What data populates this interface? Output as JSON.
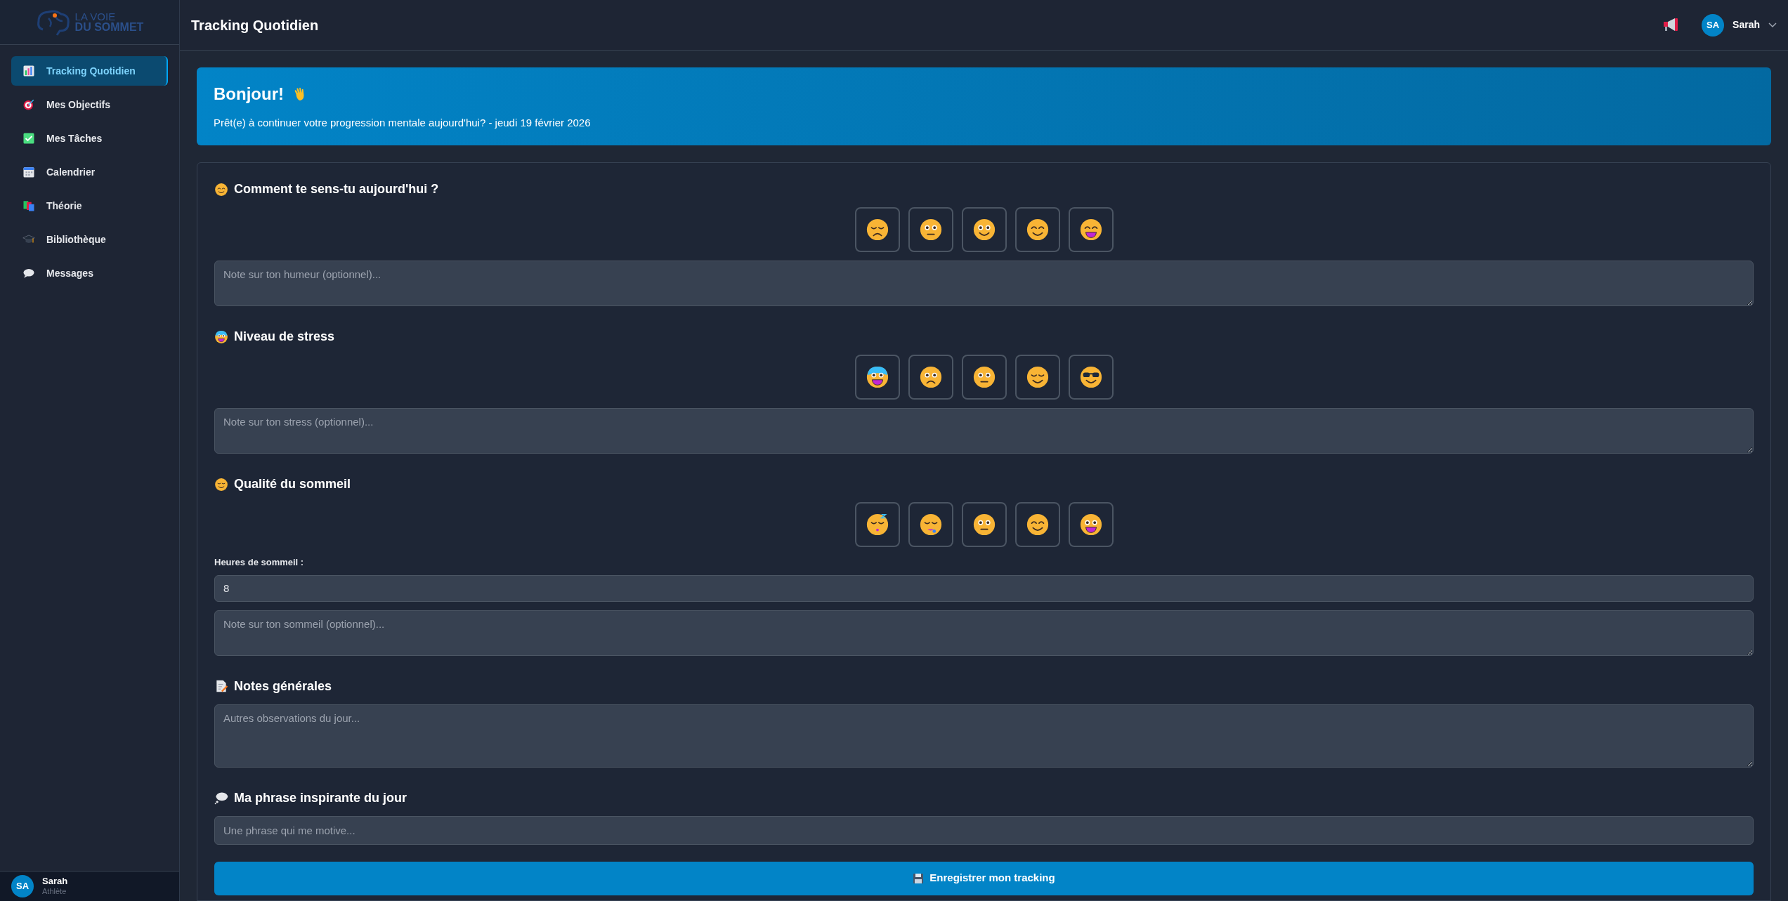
{
  "sidebar": {
    "logo": {
      "line1": "LA VOIE",
      "line2": "DU SOMMET"
    },
    "items": [
      {
        "label": "Tracking Quotidien",
        "selected": true
      },
      {
        "label": "Mes Objectifs",
        "selected": false
      },
      {
        "label": "Mes Tâches",
        "selected": false
      },
      {
        "label": "Calendrier",
        "selected": false
      },
      {
        "label": "Théorie",
        "selected": false
      },
      {
        "label": "Bibliothèque",
        "selected": false
      },
      {
        "label": "Messages",
        "selected": false
      }
    ],
    "user": {
      "initials": "SA",
      "name": "Sarah",
      "role": "Athlète"
    }
  },
  "header": {
    "title": "Tracking Quotidien",
    "user": {
      "initials": "SA",
      "name": "Sarah"
    }
  },
  "banner": {
    "title": "Bonjour!",
    "subtitle": "Prêt(e) à continuer votre progression mentale aujourd'hui? - jeudi 19 février 2026"
  },
  "sections": [
    {
      "kind": "rating",
      "title": "Comment te sens-tu aujourd'hui ?",
      "options": [
        {
          "kind": "sad",
          "selected": false
        },
        {
          "kind": "neutral",
          "selected": false
        },
        {
          "kind": "slight",
          "selected": false
        },
        {
          "kind": "smile",
          "selected": false
        },
        {
          "kind": "grin",
          "selected": false
        }
      ],
      "note": {
        "placeholder": "Note sur ton humeur (optionnel)..."
      }
    },
    {
      "kind": "rating",
      "title": "Niveau de stress",
      "options": [
        {
          "kind": "anxious",
          "selected": false
        },
        {
          "kind": "worried",
          "selected": false
        },
        {
          "kind": "neutral",
          "selected": false
        },
        {
          "kind": "relieved",
          "selected": false
        },
        {
          "kind": "cool",
          "selected": false
        }
      ],
      "note": {
        "placeholder": "Note sur ton stress (optionnel)..."
      }
    },
    {
      "kind": "sleep",
      "title": "Qualité du sommeil",
      "options": [
        {
          "kind": "sleepy",
          "selected": false
        },
        {
          "kind": "drowsy",
          "selected": false
        },
        {
          "kind": "neutral",
          "selected": false
        },
        {
          "kind": "smile",
          "selected": false
        },
        {
          "kind": "grinning",
          "selected": false
        }
      ],
      "hours": {
        "label": "Heures de sommeil :",
        "value": "8"
      },
      "note": {
        "placeholder": "Note sur ton sommeil (optionnel)..."
      }
    },
    {
      "kind": "textarea",
      "title": "Notes générales",
      "placeholder": "Autres observations du jour..."
    },
    {
      "kind": "input",
      "title": "Ma phrase inspirante du jour",
      "placeholder": "Une phrase qui me motive..."
    }
  ],
  "submit": {
    "label": "Enregistrer mon tracking"
  }
}
